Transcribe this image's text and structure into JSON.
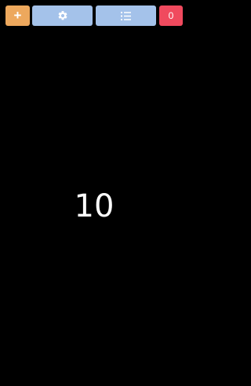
{
  "toolbar": {
    "add_button": {
      "label": "+",
      "color": "#eda85d",
      "icon": "plus-icon"
    },
    "settings_button": {
      "color": "#a4c2ea",
      "icon": "gear-icon"
    },
    "list_button": {
      "color": "#a4c2ea",
      "icon": "list-icon"
    },
    "count_badge": {
      "value": "0",
      "color": "#f04a5e"
    }
  },
  "main": {
    "number": "10",
    "background_color": "#000000",
    "text_color": "#ffffff"
  }
}
